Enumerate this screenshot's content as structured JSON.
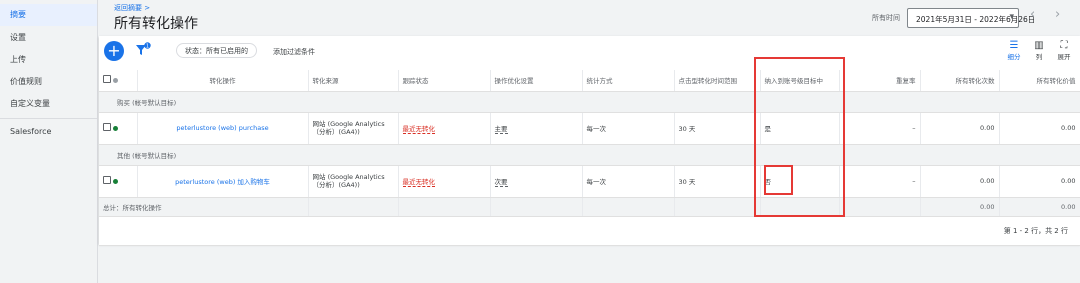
{
  "sidebar": {
    "items": [
      {
        "label": "摘要"
      },
      {
        "label": "设置"
      },
      {
        "label": "上传"
      },
      {
        "label": "价值规则"
      },
      {
        "label": "自定义变量"
      },
      {
        "label": "Salesforce"
      }
    ]
  },
  "header": {
    "back_link": "返回摘要 >",
    "title": "所有转化操作",
    "date_label": "所有时间",
    "date_range": "2021年5月31日 - 2022年6月26日"
  },
  "toolbar": {
    "add_label": "+",
    "filter_chip": "状态：所有已启用的",
    "add_filter": "添加过滤条件",
    "segment_label": "细分",
    "columns_label": "列",
    "expand_label": "展开"
  },
  "table": {
    "columns": [
      "转化操作",
      "转化来源",
      "跟踪状态",
      "操作优化设置",
      "统计方式",
      "点击型转化时间范围",
      "纳入到账号级目标中",
      "重复率",
      "所有转化次数",
      "所有转化价值"
    ],
    "groups": [
      {
        "label": "购买 (帐号默认目标)",
        "rows": [
          {
            "name": "peterlustore (web) purchase",
            "source": "网站 (Google Analytics（分析）(GA4))",
            "tracking": "最近无转化",
            "optimization": "主要",
            "count": "每一次",
            "window": "30 天",
            "included": "是",
            "dup": "–",
            "conversions": "0.00",
            "value": "0.00",
            "status_color": "#188038"
          }
        ]
      },
      {
        "label": "其他 (帐号默认目标)",
        "rows": [
          {
            "name": "peterlustore (web) 加入购物车",
            "source": "网站 (Google Analytics（分析）(GA4))",
            "tracking": "最近无转化",
            "optimization": "次要",
            "count": "每一次",
            "window": "30 天",
            "included": "否",
            "dup": "–",
            "conversions": "0.00",
            "value": "0.00",
            "status_color": "#188038"
          }
        ]
      }
    ],
    "total": {
      "label": "总计：所有转化操作",
      "conversions": "0.00",
      "value": "0.00"
    },
    "pagination": "第 1 - 2 行，共 2 行"
  },
  "colors": {
    "accent": "#1a73e8",
    "annotation": "#e53935",
    "warning": "#d93025",
    "active_status": "#188038"
  }
}
